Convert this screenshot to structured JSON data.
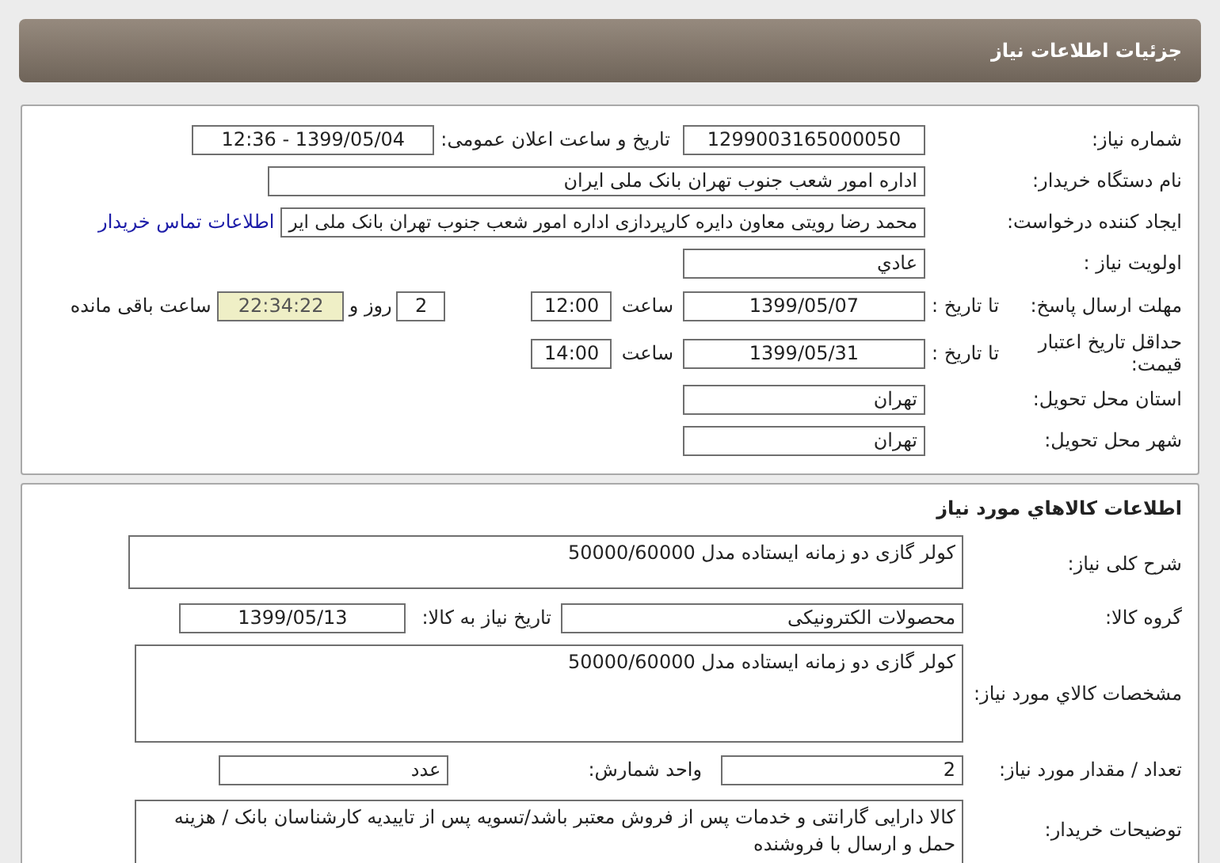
{
  "header": {
    "title": "جزئیات اطلاعات نیاز"
  },
  "need": {
    "need_number": {
      "label": "شماره نیاز:",
      "value": "1299003165000050"
    },
    "announce": {
      "label": "تاریخ و ساعت اعلان عمومی:",
      "value": "1399/05/04 - 12:36"
    },
    "buyer": {
      "label": "نام دستگاه خریدار:",
      "value": "اداره امور شعب جنوب تهران بانک ملی ایران"
    },
    "requester": {
      "label": "ایجاد کننده درخواست:",
      "value": "محمد رضا رویتی معاون دایره کارپردازی اداره امور شعب جنوب تهران بانک ملی ایر",
      "link": "اطلاعات تماس خریدار"
    },
    "priority": {
      "label": "اولویت نیاز :",
      "value": "عادي"
    },
    "deadline": {
      "label": "مهلت ارسال پاسخ:",
      "date_label": "تا تاریخ :",
      "date": "1399/05/07",
      "time_label": "ساعت",
      "time": "12:00",
      "days": "2",
      "days_label": "روز و",
      "remaining": "22:34:22",
      "remaining_label": "ساعت باقی مانده"
    },
    "validity": {
      "label": "حداقل تاریخ اعتبار قیمت:",
      "date_label": "تا تاریخ :",
      "date": "1399/05/31",
      "time_label": "ساعت",
      "time": "14:00"
    },
    "province": {
      "label": "استان محل تحویل:",
      "value": "تهران"
    },
    "city": {
      "label": "شهر محل تحویل:",
      "value": "تهران"
    }
  },
  "goods": {
    "title": "اطلاعات کالاهاي مورد نیاز",
    "summary": {
      "label": "شرح کلی نیاز:",
      "value": "کولر گازی دو زمانه ایستاده مدل 50000/60000"
    },
    "group": {
      "label": "گروه کالا:",
      "value": "محصولات الکترونیکی",
      "need_date_label": "تاریخ نیاز به کالا:",
      "need_date": "1399/05/13"
    },
    "specs": {
      "label": "مشخصات کالاي مورد نیاز:",
      "value": "کولر گازی دو زمانه ایستاده مدل 50000/60000"
    },
    "quantity": {
      "label": "تعداد / مقدار مورد نیاز:",
      "value": "2",
      "unit_label": "واحد شمارش:",
      "unit": "عدد"
    },
    "notes": {
      "label": "توضیحات خریدار:",
      "value": "کالا دارایی گارانتی و خدمات پس از فروش معتبر باشد/تسویه پس از تاییدیه کارشناسان بانک / هزینه حمل و ارسال با فروشنده"
    }
  }
}
